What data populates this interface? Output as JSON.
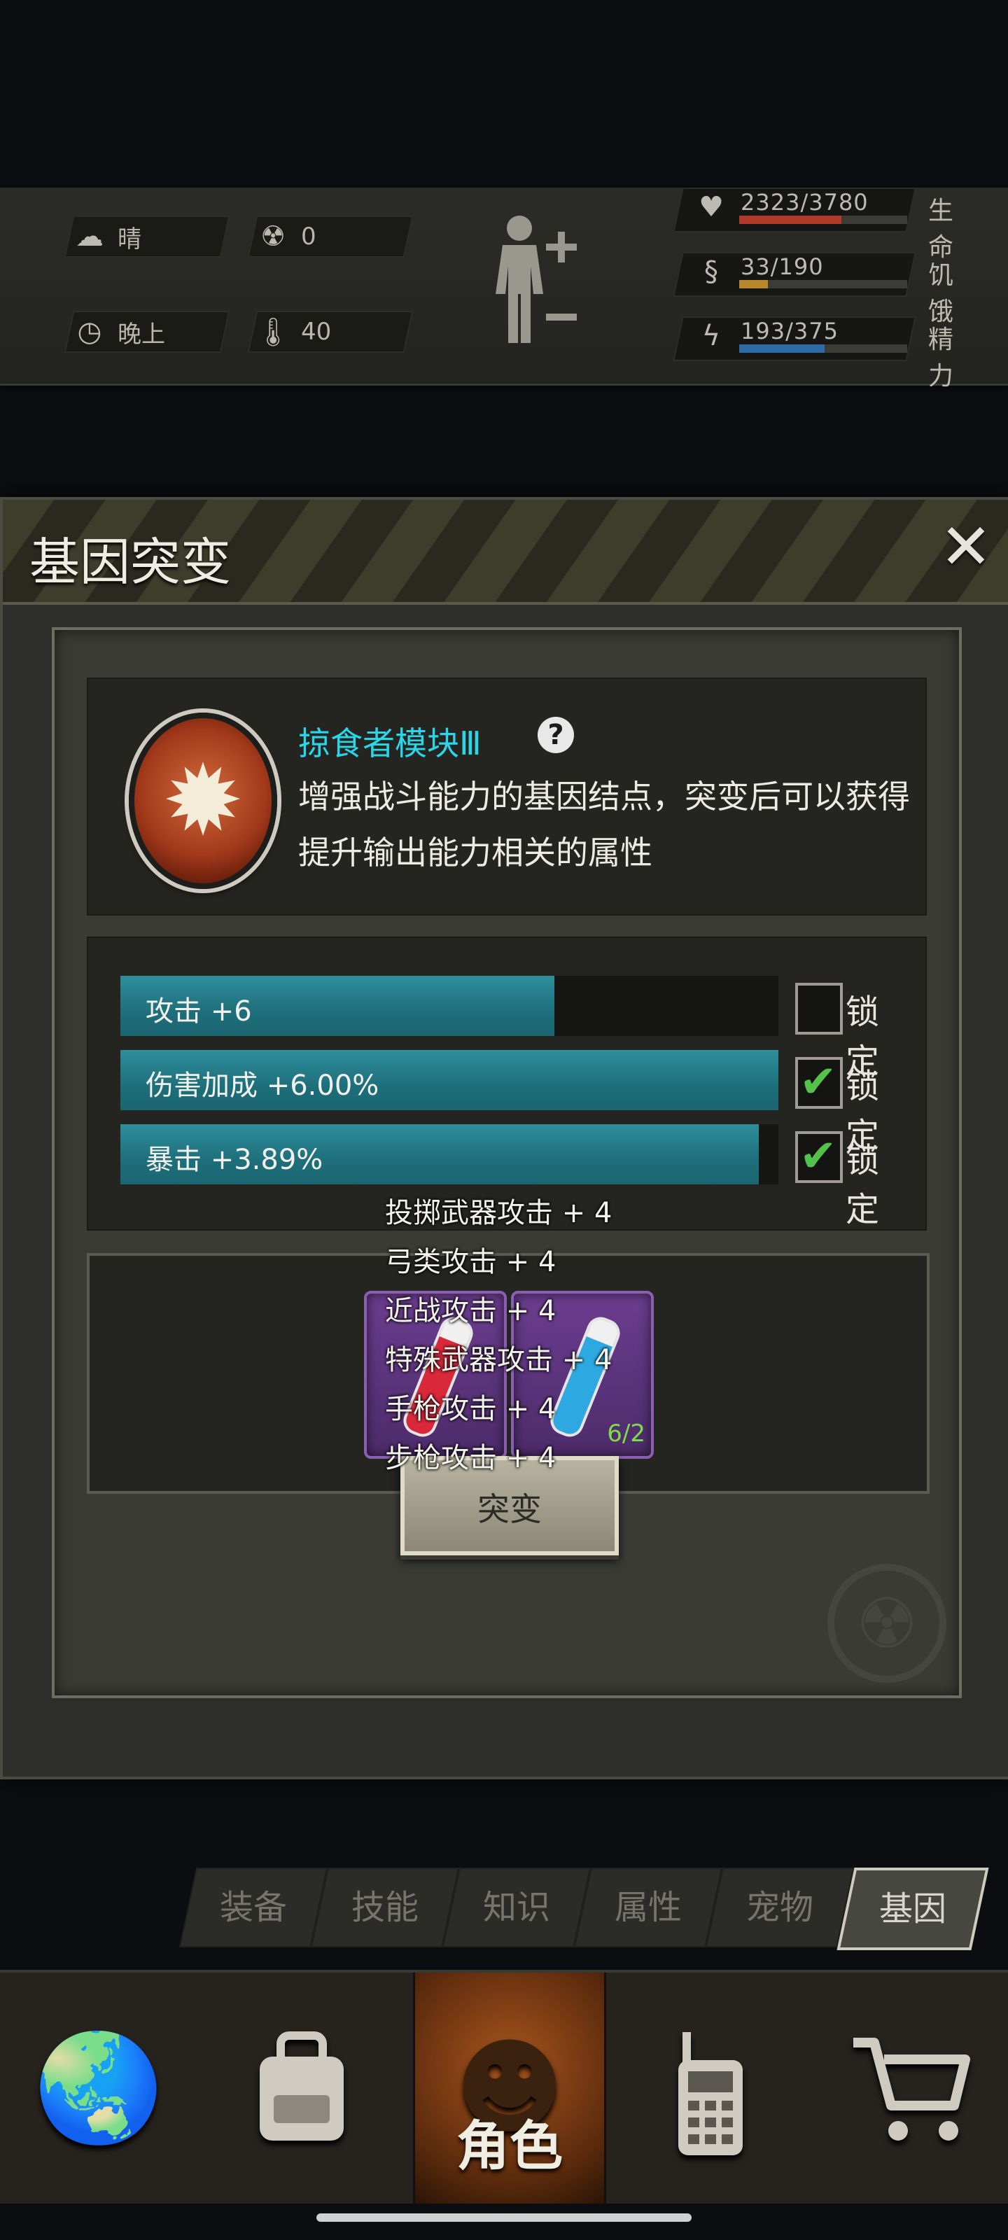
{
  "hud": {
    "weather": {
      "value": "晴",
      "icon": "cloud-sun-icon"
    },
    "radiation": {
      "value": "0",
      "icon": "radiation-icon"
    },
    "time": {
      "value": "晚上",
      "icon": "clock-icon"
    },
    "temperature": {
      "value": "40",
      "icon": "thermometer-icon"
    },
    "body_icon": "body-plus-minus-icon",
    "stats": [
      {
        "value": "2323/3780",
        "label": "生命",
        "fraction": 0.61,
        "color": "#b23a2a",
        "icon": "heart-icon"
      },
      {
        "value": "33/190",
        "label": "饥饿",
        "fraction": 0.17,
        "color": "#b8862b",
        "icon": "stomach-icon"
      },
      {
        "value": "193/375",
        "label": "精力",
        "fraction": 0.51,
        "color": "#2e6aa3",
        "icon": "brain-icon"
      }
    ]
  },
  "dialog": {
    "title": "基因突变",
    "close_label": "✕",
    "gene": {
      "name": "掠食者模块Ⅲ",
      "help": "?",
      "description": "增强战斗能力的基因结点，突变后可以获得提升输出能力相关的属性"
    },
    "attributes": [
      {
        "text": "攻击 +6",
        "fraction": 0.66,
        "locked": false,
        "lock_label": "锁定"
      },
      {
        "text": "伤害加成 +6.00%",
        "fraction": 1.0,
        "locked": true,
        "lock_label": "锁定"
      },
      {
        "text": "暴击 +3.89%",
        "fraction": 0.97,
        "locked": true,
        "lock_label": "锁定"
      }
    ],
    "materials": [
      {
        "name": "red-serum",
        "count": "",
        "color": "#d8283a"
      },
      {
        "name": "blue-serum",
        "count": "6/2",
        "color": "#2ea8e0"
      }
    ],
    "tooltip_lines": [
      "投掷武器攻击 + 4",
      "弓类攻击 + 4",
      "近战攻击 + 4",
      "特殊武器攻击 + 4",
      "手枪攻击 + 4",
      "步枪攻击 + 4"
    ],
    "mutate_label": "突变"
  },
  "subtabs": [
    {
      "label": "装备",
      "active": false
    },
    {
      "label": "技能",
      "active": false
    },
    {
      "label": "知识",
      "active": false
    },
    {
      "label": "属性",
      "active": false
    },
    {
      "label": "宠物",
      "active": false
    },
    {
      "label": "基因",
      "active": true
    }
  ],
  "bottom_nav": {
    "role_label": "角色",
    "items": [
      "globe-icon",
      "backpack-icon",
      "role-icon",
      "radio-icon",
      "cart-icon"
    ]
  }
}
